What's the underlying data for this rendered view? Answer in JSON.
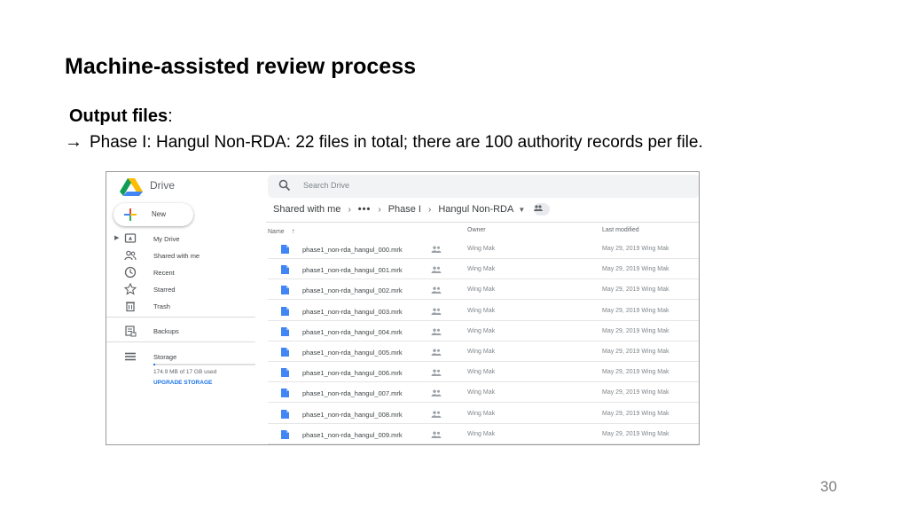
{
  "slide": {
    "title": "Machine-assisted review process",
    "subheading_bold": "Output files",
    "subheading_colon": ":",
    "bullet_arrow": "→",
    "bullet_text": "Phase I: Hangul Non-RDA: 22 files in total; there are 100 authority records per file.",
    "page_number": "30"
  },
  "drive": {
    "app_name": "Drive",
    "search_placeholder": "Search Drive",
    "new_label": "New",
    "sidebar": {
      "items": [
        {
          "label": "My Drive",
          "icon": "my-drive-icon"
        },
        {
          "label": "Shared with me",
          "icon": "shared-people-icon"
        },
        {
          "label": "Recent",
          "icon": "clock-icon"
        },
        {
          "label": "Starred",
          "icon": "star-icon"
        },
        {
          "label": "Trash",
          "icon": "trash-icon"
        },
        {
          "label": "Backups",
          "icon": "backup-icon"
        },
        {
          "label": "Storage",
          "icon": "storage-icon"
        }
      ],
      "storage_used": "174.9 MB of 17 GB used",
      "storage_fraction": 0.01,
      "upgrade_label": "UPGRADE STORAGE"
    },
    "breadcrumb": {
      "items": [
        "Shared with me",
        "•••",
        "Phase I",
        "Hangul Non-RDA"
      ]
    },
    "columns": {
      "name": "Name",
      "owner": "Owner",
      "last_modified": "Last modified"
    },
    "files": [
      {
        "name": "phase1_non-rda_hangul_000.mrk",
        "owner": "Wing Mak",
        "modified": "May 29, 2019 Wing Mak"
      },
      {
        "name": "phase1_non-rda_hangul_001.mrk",
        "owner": "Wing Mak",
        "modified": "May 29, 2019 Wing Mak"
      },
      {
        "name": "phase1_non-rda_hangul_002.mrk",
        "owner": "Wing Mak",
        "modified": "May 29, 2019 Wing Mak"
      },
      {
        "name": "phase1_non-rda_hangul_003.mrk",
        "owner": "Wing Mak",
        "modified": "May 29, 2019 Wing Mak"
      },
      {
        "name": "phase1_non-rda_hangul_004.mrk",
        "owner": "Wing Mak",
        "modified": "May 29, 2019 Wing Mak"
      },
      {
        "name": "phase1_non-rda_hangul_005.mrk",
        "owner": "Wing Mak",
        "modified": "May 29, 2019 Wing Mak"
      },
      {
        "name": "phase1_non-rda_hangul_006.mrk",
        "owner": "Wing Mak",
        "modified": "May 29, 2019 Wing Mak"
      },
      {
        "name": "phase1_non-rda_hangul_007.mrk",
        "owner": "Wing Mak",
        "modified": "May 29, 2019 Wing Mak"
      },
      {
        "name": "phase1_non-rda_hangul_008.mrk",
        "owner": "Wing Mak",
        "modified": "May 29, 2019 Wing Mak"
      },
      {
        "name": "phase1_non-rda_hangul_009.mrk",
        "owner": "Wing Mak",
        "modified": "May 29, 2019 Wing Mak"
      }
    ],
    "colors": {
      "file_blue": "#4285f4",
      "accent_blue": "#1a73e8"
    }
  }
}
